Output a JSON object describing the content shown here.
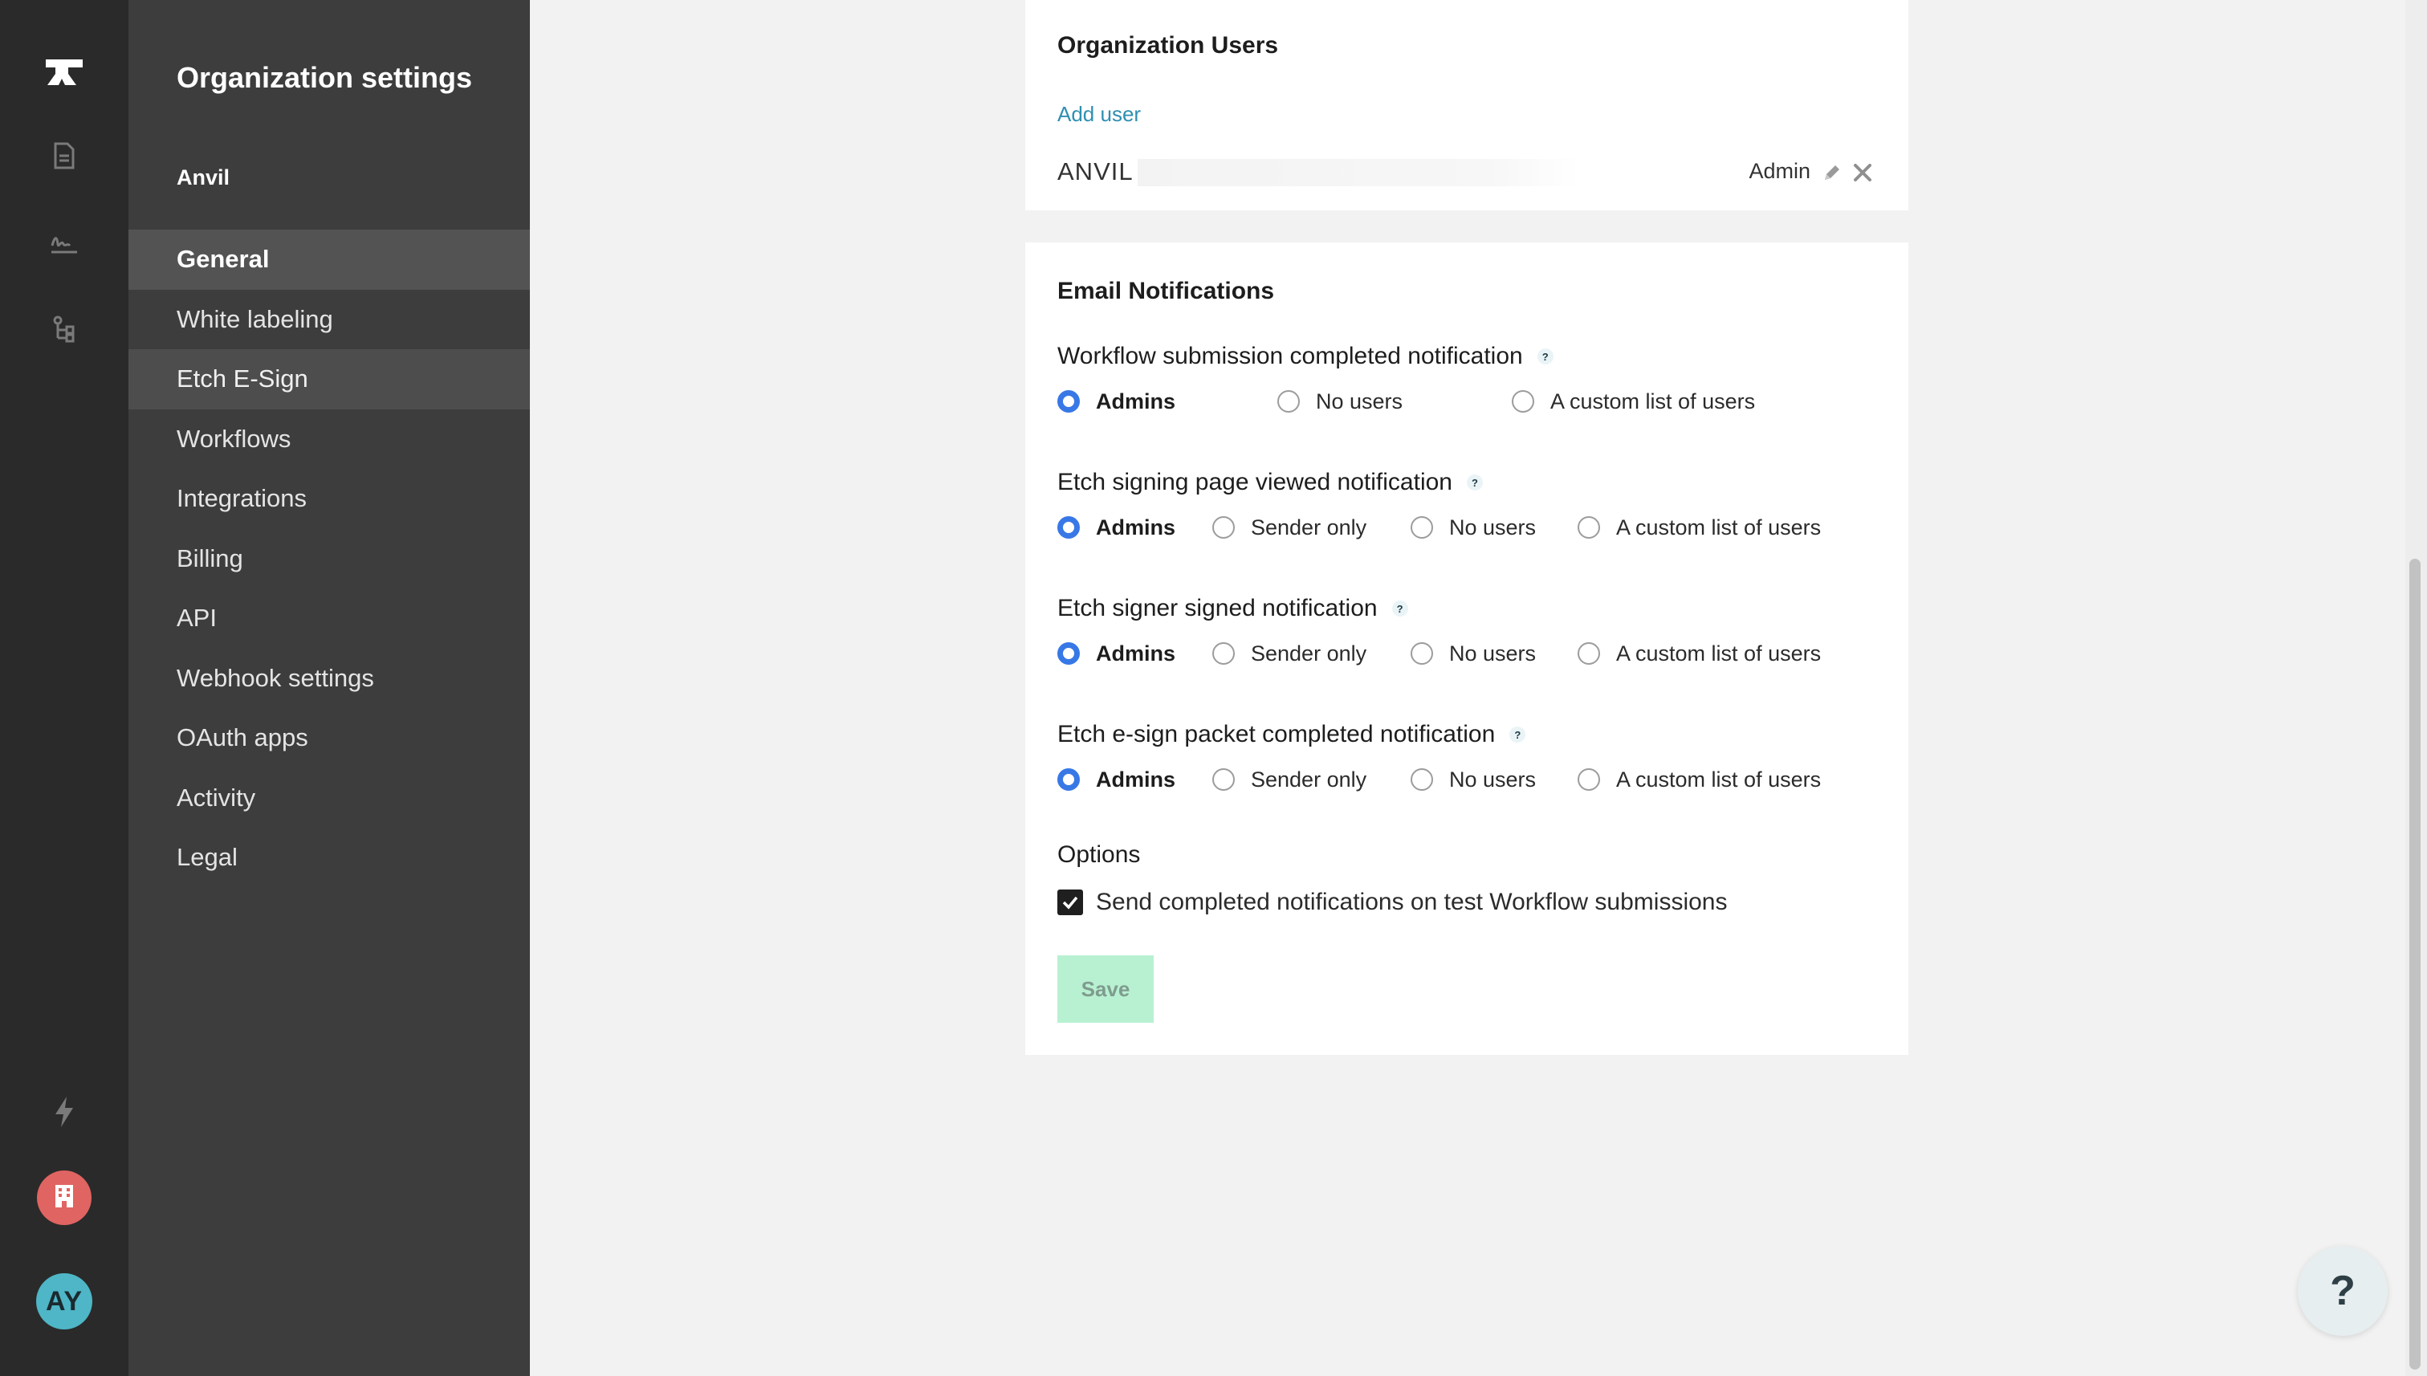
{
  "sidebar": {
    "title": "Organization settings",
    "org_name": "Anvil",
    "items": [
      {
        "label": "General",
        "state": "active"
      },
      {
        "label": "White labeling",
        "state": ""
      },
      {
        "label": "Etch E-Sign",
        "state": "hover"
      },
      {
        "label": "Workflows",
        "state": ""
      },
      {
        "label": "Integrations",
        "state": ""
      },
      {
        "label": "Billing",
        "state": ""
      },
      {
        "label": "API",
        "state": ""
      },
      {
        "label": "Webhook settings",
        "state": ""
      },
      {
        "label": "OAuth apps",
        "state": ""
      },
      {
        "label": "Activity",
        "state": ""
      },
      {
        "label": "Legal",
        "state": ""
      }
    ]
  },
  "rail": {
    "logo_icon": "anvil-logo-icon",
    "icons": [
      "documents-icon",
      "signature-icon",
      "workflow-tree-icon",
      "lightning-icon"
    ],
    "org_icon": "building-icon",
    "avatar_initials": "AY"
  },
  "users_card": {
    "title": "Organization Users",
    "add_user_label": "Add user",
    "user": {
      "name": "ANVIL",
      "role": "Admin"
    }
  },
  "email_card": {
    "title": "Email Notifications",
    "groups": [
      {
        "label": "Workflow submission completed notification",
        "options": [
          "Admins",
          "No users",
          "A custom list of users"
        ],
        "selected": 0
      },
      {
        "label": "Etch signing page viewed notification",
        "options": [
          "Admins",
          "Sender only",
          "No users",
          "A custom list of users"
        ],
        "selected": 0
      },
      {
        "label": "Etch signer signed notification",
        "options": [
          "Admins",
          "Sender only",
          "No users",
          "A custom list of users"
        ],
        "selected": 0
      },
      {
        "label": "Etch e-sign packet completed notification",
        "options": [
          "Admins",
          "Sender only",
          "No users",
          "A custom list of users"
        ],
        "selected": 0
      }
    ],
    "help_marker": "?",
    "options_label": "Options",
    "checkbox_label": "Send completed notifications on test Workflow submissions",
    "checkbox_checked": true,
    "save_label": "Save"
  },
  "help_button_label": "?",
  "colors": {
    "rail_bg": "#2a2a2a",
    "sidebar_bg": "#3d3d3d",
    "accent_link": "#2e8fb1",
    "radio_selected": "#3878e6",
    "save_bg": "#b8f1d2",
    "org_badge": "#e06461",
    "avatar": "#4eb6c6"
  }
}
